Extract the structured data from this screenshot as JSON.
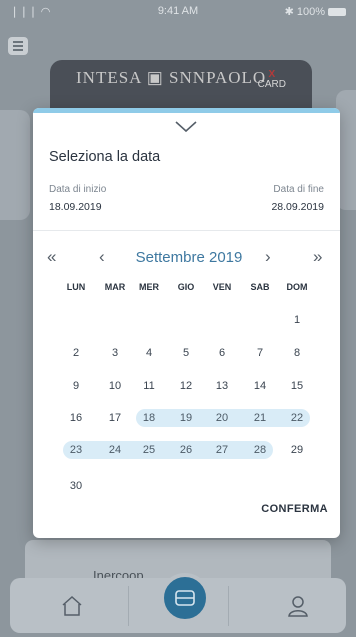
{
  "status_bar": {
    "signal": "❘❘❘ ◠",
    "time": "9:41 AM",
    "battery": "✱ 100%"
  },
  "background": {
    "card_bank": "INTESA ▣ SNNPAOLO",
    "card_brand_top": "X",
    "card_brand_bottom": "CARD",
    "lower_panel_text": "Inercoop"
  },
  "modal": {
    "title": "Seleziona la data",
    "start_label": "Data di inizio",
    "start_value": "18.09.2019",
    "end_label": "Data di fine",
    "end_value": "28.09.2019",
    "month_title": "Settembre 2019",
    "prev_year": "«",
    "prev_month": "‹",
    "next_month": "›",
    "next_year": "»",
    "weekdays": [
      "LUN",
      "MAR",
      "MER",
      "GIO",
      "VEN",
      "SAB",
      "DOM"
    ],
    "weeks": [
      [
        "",
        "",
        "",
        "",
        "",
        "",
        "1"
      ],
      [
        "2",
        "3",
        "4",
        "5",
        "6",
        "7",
        "8"
      ],
      [
        "9",
        "10",
        "11",
        "12",
        "13",
        "14",
        "15"
      ],
      [
        "16",
        "17",
        "18",
        "19",
        "20",
        "21",
        "22"
      ],
      [
        "23",
        "24",
        "25",
        "26",
        "27",
        "28",
        "29"
      ],
      [
        "30",
        "",
        "",
        "",
        "",
        "",
        ""
      ]
    ],
    "range_start": 18,
    "range_end": 28,
    "confirm_label": "CONFERMA",
    "accent_color": "#3e78a0",
    "range_color": "#d9ecf7"
  }
}
